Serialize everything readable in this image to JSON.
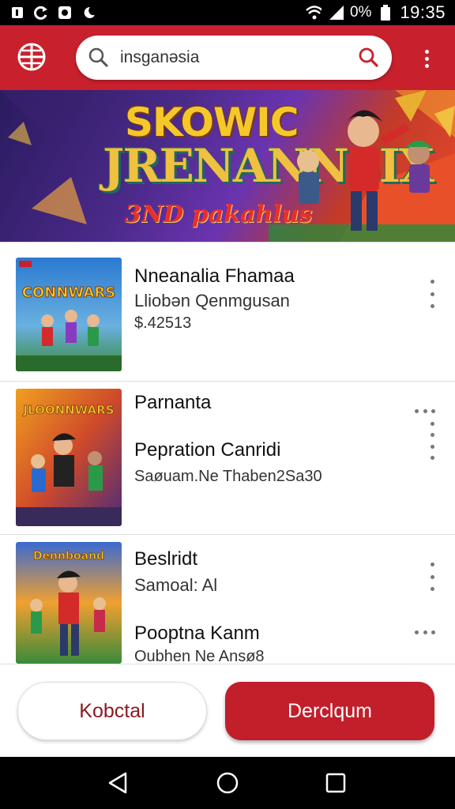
{
  "status_bar": {
    "battery_text": "0%",
    "time": "19:35",
    "icons": [
      "notification-icon",
      "sync-icon",
      "photo-icon",
      "moon-icon",
      "wifi-icon",
      "signal-icon",
      "battery-icon"
    ]
  },
  "app_bar": {
    "search_query": "insganəsia",
    "icons": [
      "globe-icon",
      "search-icon",
      "more-vert-icon"
    ]
  },
  "banner": {
    "title": "SKOWIC",
    "subtitle": "JRENANNSIX",
    "tagline": "3ND pakahlus"
  },
  "list": [
    {
      "title": "Nneanalia Fhamaa",
      "subtitle": "Lliobən Qenmgusan",
      "price": "$.42513"
    },
    {
      "title": "Parnanta",
      "subtitle": "Pepration Canridi",
      "meta": "Saøuam.Ne Thaben2Sa30"
    },
    {
      "title": "Beslridt",
      "subtitle": "Samoal: Al",
      "title2": "Pooptna Kanm",
      "meta": "Oubhen Ne Ansø8"
    }
  ],
  "buttons": {
    "secondary_label": "Kobctal",
    "primary_label": "Derclqum"
  },
  "colors": {
    "accent": "#c8202d",
    "button_primary": "#c21f2b"
  },
  "nav_bar": {
    "icons": [
      "back-icon",
      "home-icon",
      "recents-icon"
    ]
  }
}
